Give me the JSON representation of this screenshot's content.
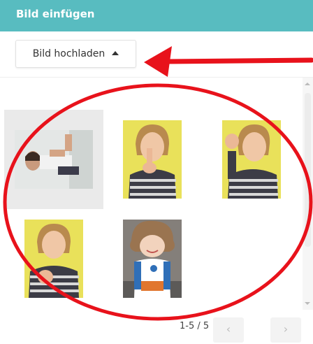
{
  "dialog": {
    "title": "Bild einfügen"
  },
  "toolbar": {
    "upload_label": "Bild hochladen",
    "upload_icon": "caret-up-icon"
  },
  "gallery": {
    "images": [
      {
        "id": "man-sign",
        "selected": true
      },
      {
        "id": "child-finger-nose",
        "selected": false
      },
      {
        "id": "child-fist-raised",
        "selected": false
      },
      {
        "id": "child-fist-chest",
        "selected": false
      },
      {
        "id": "plush-doll",
        "selected": false
      }
    ]
  },
  "pagination": {
    "range": "1-5 / 5",
    "prev_icon": "chevron-left-icon",
    "next_icon": "chevron-right-icon"
  },
  "colors": {
    "header": "#58bcc0",
    "annotation": "#e8121b"
  }
}
